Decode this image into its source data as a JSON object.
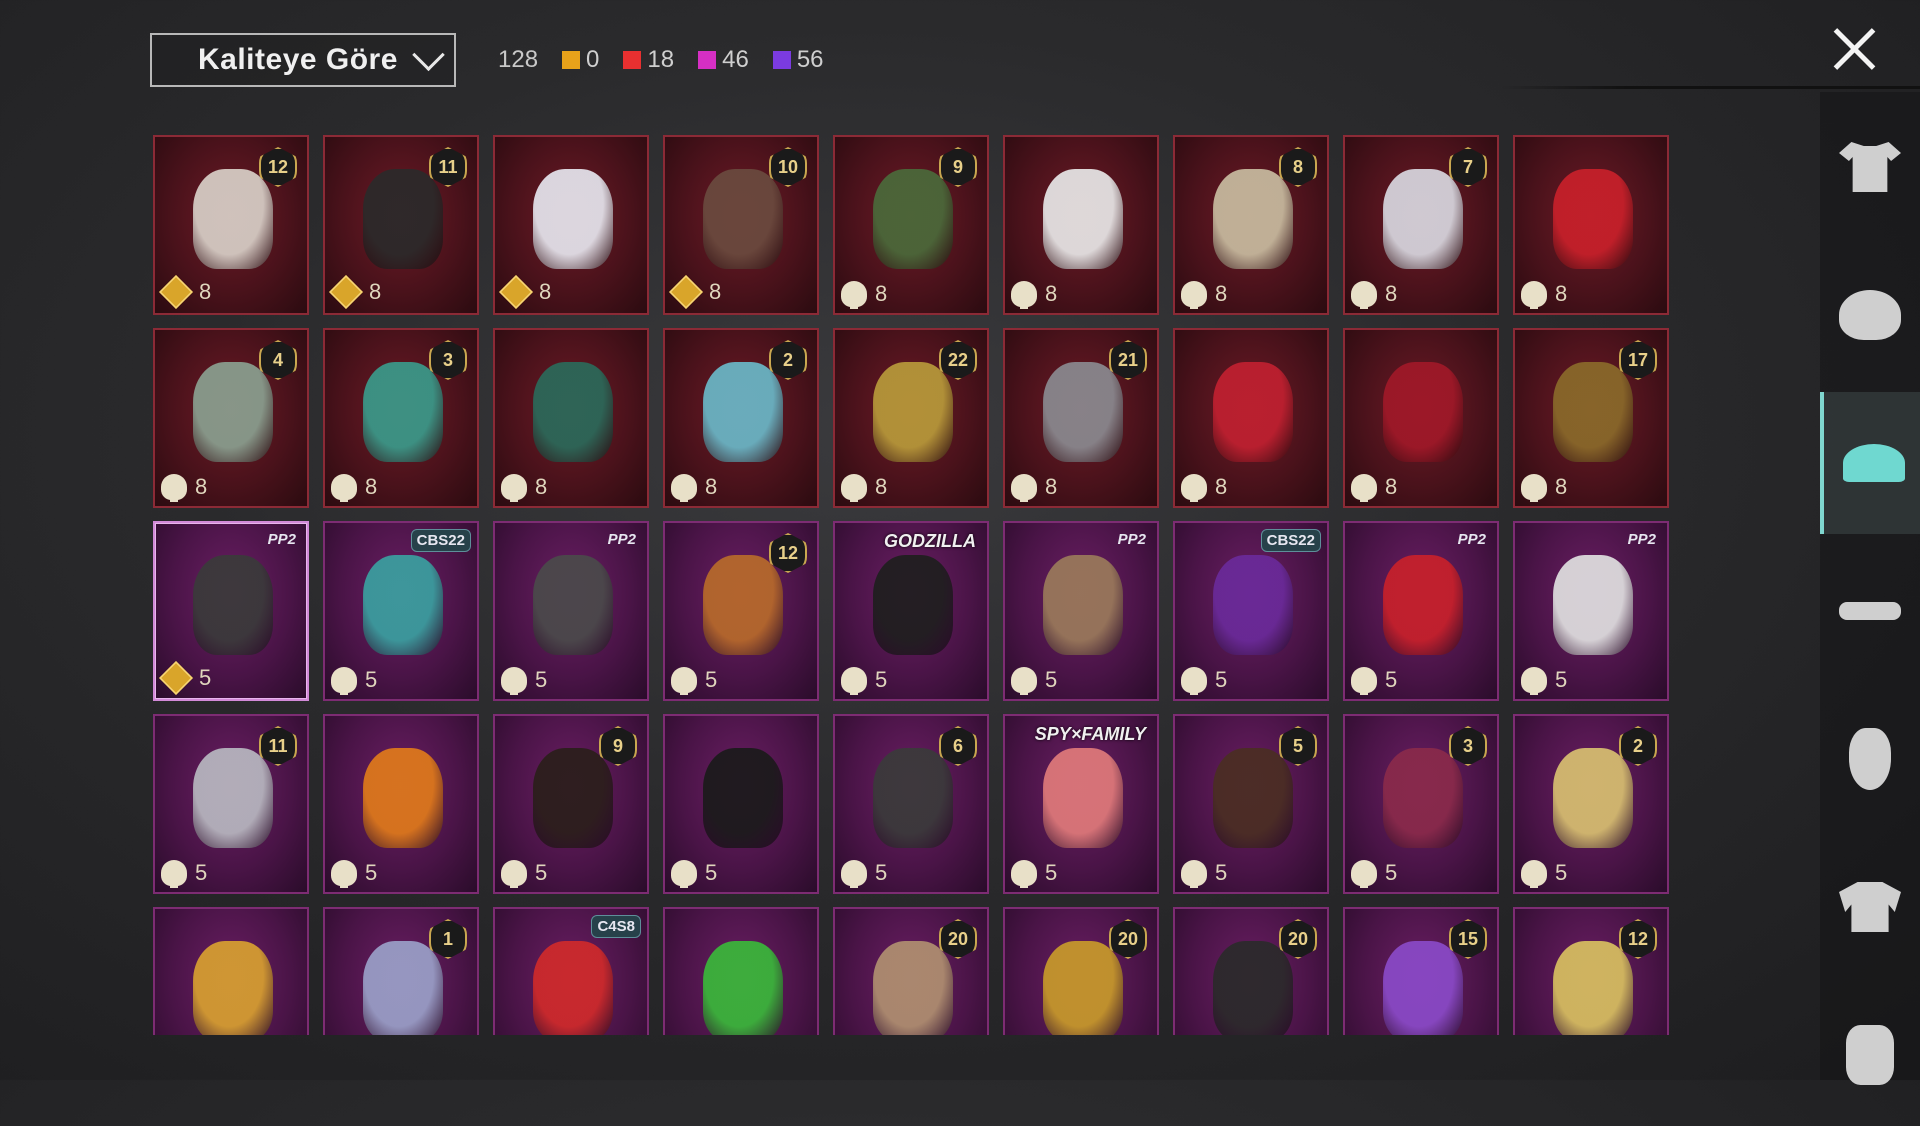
{
  "header": {
    "sort_label": "Kaliteye Göre",
    "total_count": "128",
    "rarity_counts": [
      {
        "color": "#e8a21a",
        "count": "0"
      },
      {
        "color": "#e83030",
        "count": "18"
      },
      {
        "color": "#d62fc4",
        "count": "46"
      },
      {
        "color": "#7b3be0",
        "count": "56"
      }
    ]
  },
  "items": [
    {
      "tier": "red",
      "badge": "12",
      "badge_type": "level",
      "price": "8",
      "currency": "diamond",
      "color": "#d8d0c8",
      "selected": false
    },
    {
      "tier": "red",
      "badge": "11",
      "badge_type": "level",
      "price": "8",
      "currency": "diamond",
      "color": "#2a2a2a",
      "selected": false
    },
    {
      "tier": "red",
      "badge": "",
      "badge_type": "none",
      "price": "8",
      "currency": "diamond",
      "color": "#e6e6ee",
      "selected": false
    },
    {
      "tier": "red",
      "badge": "10",
      "badge_type": "level",
      "price": "8",
      "currency": "diamond",
      "color": "#6a4a3e",
      "selected": false
    },
    {
      "tier": "red",
      "badge": "9",
      "badge_type": "level",
      "price": "8",
      "currency": "cloud",
      "color": "#4a6a3a",
      "selected": false
    },
    {
      "tier": "red",
      "badge": "",
      "badge_type": "none",
      "price": "8",
      "currency": "cloud",
      "color": "#e8e8e8",
      "selected": false
    },
    {
      "tier": "red",
      "badge": "8",
      "badge_type": "level",
      "price": "8",
      "currency": "cloud",
      "color": "#c8bca0",
      "selected": false
    },
    {
      "tier": "red",
      "badge": "7",
      "badge_type": "level",
      "price": "8",
      "currency": "cloud",
      "color": "#d8d8e0",
      "selected": false
    },
    {
      "tier": "red",
      "badge": "",
      "badge_type": "none",
      "price": "8",
      "currency": "cloud",
      "color": "#c8202a",
      "selected": false
    },
    {
      "tier": "red",
      "badge": "4",
      "badge_type": "level",
      "price": "8",
      "currency": "cloud",
      "color": "#8aa090",
      "selected": false
    },
    {
      "tier": "red",
      "badge": "3",
      "badge_type": "level",
      "price": "8",
      "currency": "cloud",
      "color": "#3a9a8a",
      "selected": false
    },
    {
      "tier": "red",
      "badge": "",
      "badge_type": "none",
      "price": "8",
      "currency": "cloud",
      "color": "#2a6a5a",
      "selected": false
    },
    {
      "tier": "red",
      "badge": "2",
      "badge_type": "level",
      "price": "8",
      "currency": "cloud",
      "color": "#6ab8c8",
      "selected": false
    },
    {
      "tier": "red",
      "badge": "22",
      "badge_type": "level",
      "price": "8",
      "currency": "cloud",
      "color": "#b89a3a",
      "selected": false
    },
    {
      "tier": "red",
      "badge": "21",
      "badge_type": "level",
      "price": "8",
      "currency": "cloud",
      "color": "#8a8a90",
      "selected": false
    },
    {
      "tier": "red",
      "badge": "",
      "badge_type": "none",
      "price": "8",
      "currency": "cloud",
      "color": "#c02030",
      "selected": false
    },
    {
      "tier": "red",
      "badge": "",
      "badge_type": "none",
      "price": "8",
      "currency": "cloud",
      "color": "#a01828",
      "selected": false
    },
    {
      "tier": "red",
      "badge": "17",
      "badge_type": "level",
      "price": "8",
      "currency": "cloud",
      "color": "#8a6a2a",
      "selected": false
    },
    {
      "tier": "purple",
      "badge": "PP2",
      "badge_type": "tag",
      "price": "5",
      "currency": "diamond",
      "color": "#3a3a3a",
      "selected": true
    },
    {
      "tier": "purple",
      "badge": "CBS22",
      "badge_type": "code",
      "price": "5",
      "currency": "cloud",
      "color": "#3aa0a0",
      "selected": false
    },
    {
      "tier": "purple",
      "badge": "PP2",
      "badge_type": "tag",
      "price": "5",
      "currency": "cloud",
      "color": "#4a4a4a",
      "selected": false
    },
    {
      "tier": "purple",
      "badge": "12",
      "badge_type": "level",
      "price": "5",
      "currency": "cloud",
      "color": "#b86a2a",
      "selected": false
    },
    {
      "tier": "purple",
      "badge": "GODZILLA",
      "badge_type": "text",
      "price": "5",
      "currency": "cloud",
      "color": "#1e1e1e",
      "selected": false
    },
    {
      "tier": "purple",
      "badge": "PP2",
      "badge_type": "tag",
      "price": "5",
      "currency": "cloud",
      "color": "#9a7a5a",
      "selected": false
    },
    {
      "tier": "purple",
      "badge": "CBS22",
      "badge_type": "code",
      "price": "5",
      "currency": "cloud",
      "color": "#6a2a9a",
      "selected": false
    },
    {
      "tier": "purple",
      "badge": "PP2",
      "badge_type": "tag",
      "price": "5",
      "currency": "cloud",
      "color": "#c8202a",
      "selected": false
    },
    {
      "tier": "purple",
      "badge": "PP2",
      "badge_type": "tag",
      "price": "5",
      "currency": "cloud",
      "color": "#e0e0e0",
      "selected": false
    },
    {
      "tier": "purple",
      "badge": "11",
      "badge_type": "level",
      "price": "5",
      "currency": "cloud",
      "color": "#b8b8c0",
      "selected": false
    },
    {
      "tier": "purple",
      "badge": "",
      "badge_type": "none",
      "price": "5",
      "currency": "cloud",
      "color": "#e07a1a",
      "selected": false
    },
    {
      "tier": "purple",
      "badge": "9",
      "badge_type": "level",
      "price": "5",
      "currency": "cloud",
      "color": "#2a1e1a",
      "selected": false
    },
    {
      "tier": "purple",
      "badge": "",
      "badge_type": "none",
      "price": "5",
      "currency": "cloud",
      "color": "#1a1a1a",
      "selected": false
    },
    {
      "tier": "purple",
      "badge": "6",
      "badge_type": "level",
      "price": "5",
      "currency": "cloud",
      "color": "#3a3a3a",
      "selected": false
    },
    {
      "tier": "purple",
      "badge": "SPY×FAMILY",
      "badge_type": "text",
      "price": "5",
      "currency": "cloud",
      "color": "#e07a7a",
      "selected": false
    },
    {
      "tier": "purple",
      "badge": "5",
      "badge_type": "level",
      "price": "5",
      "currency": "cloud",
      "color": "#4a2e22",
      "selected": false
    },
    {
      "tier": "purple",
      "badge": "3",
      "badge_type": "level",
      "price": "5",
      "currency": "cloud",
      "color": "#8a2a4a",
      "selected": false
    },
    {
      "tier": "purple",
      "badge": "2",
      "badge_type": "level",
      "price": "5",
      "currency": "cloud",
      "color": "#d8c070",
      "selected": false
    },
    {
      "tier": "purple",
      "badge": "",
      "badge_type": "none",
      "price": "",
      "currency": "none",
      "color": "#d8a030",
      "selected": false
    },
    {
      "tier": "purple",
      "badge": "1",
      "badge_type": "level",
      "price": "",
      "currency": "none",
      "color": "#9aa0c8",
      "selected": false
    },
    {
      "tier": "purple",
      "badge": "C4S8",
      "badge_type": "code",
      "price": "",
      "currency": "none",
      "color": "#d02a2a",
      "selected": false
    },
    {
      "tier": "purple",
      "badge": "",
      "badge_type": "none",
      "price": "",
      "currency": "none",
      "color": "#3ab83a",
      "selected": false
    },
    {
      "tier": "purple",
      "badge": "20",
      "badge_type": "level",
      "price": "",
      "currency": "none",
      "color": "#b09070",
      "selected": false
    },
    {
      "tier": "purple",
      "badge": "20",
      "badge_type": "level",
      "price": "",
      "currency": "none",
      "color": "#c89a2a",
      "selected": false
    },
    {
      "tier": "purple",
      "badge": "20",
      "badge_type": "level",
      "price": "",
      "currency": "none",
      "color": "#2a2a2a",
      "selected": false
    },
    {
      "tier": "purple",
      "badge": "15",
      "badge_type": "level",
      "price": "",
      "currency": "none",
      "color": "#8a4ac8",
      "selected": false
    },
    {
      "tier": "purple",
      "badge": "12",
      "badge_type": "level",
      "price": "",
      "currency": "none",
      "color": "#d8c060",
      "selected": false
    }
  ],
  "sidebar": [
    {
      "icon": "shirt-icon",
      "active": false
    },
    {
      "icon": "hair-icon",
      "active": false
    },
    {
      "icon": "cap-icon",
      "active": true
    },
    {
      "icon": "glasses-icon",
      "active": false
    },
    {
      "icon": "mask-icon",
      "active": false
    },
    {
      "icon": "jacket-icon",
      "active": false
    },
    {
      "icon": "backpack-icon",
      "active": false
    }
  ]
}
